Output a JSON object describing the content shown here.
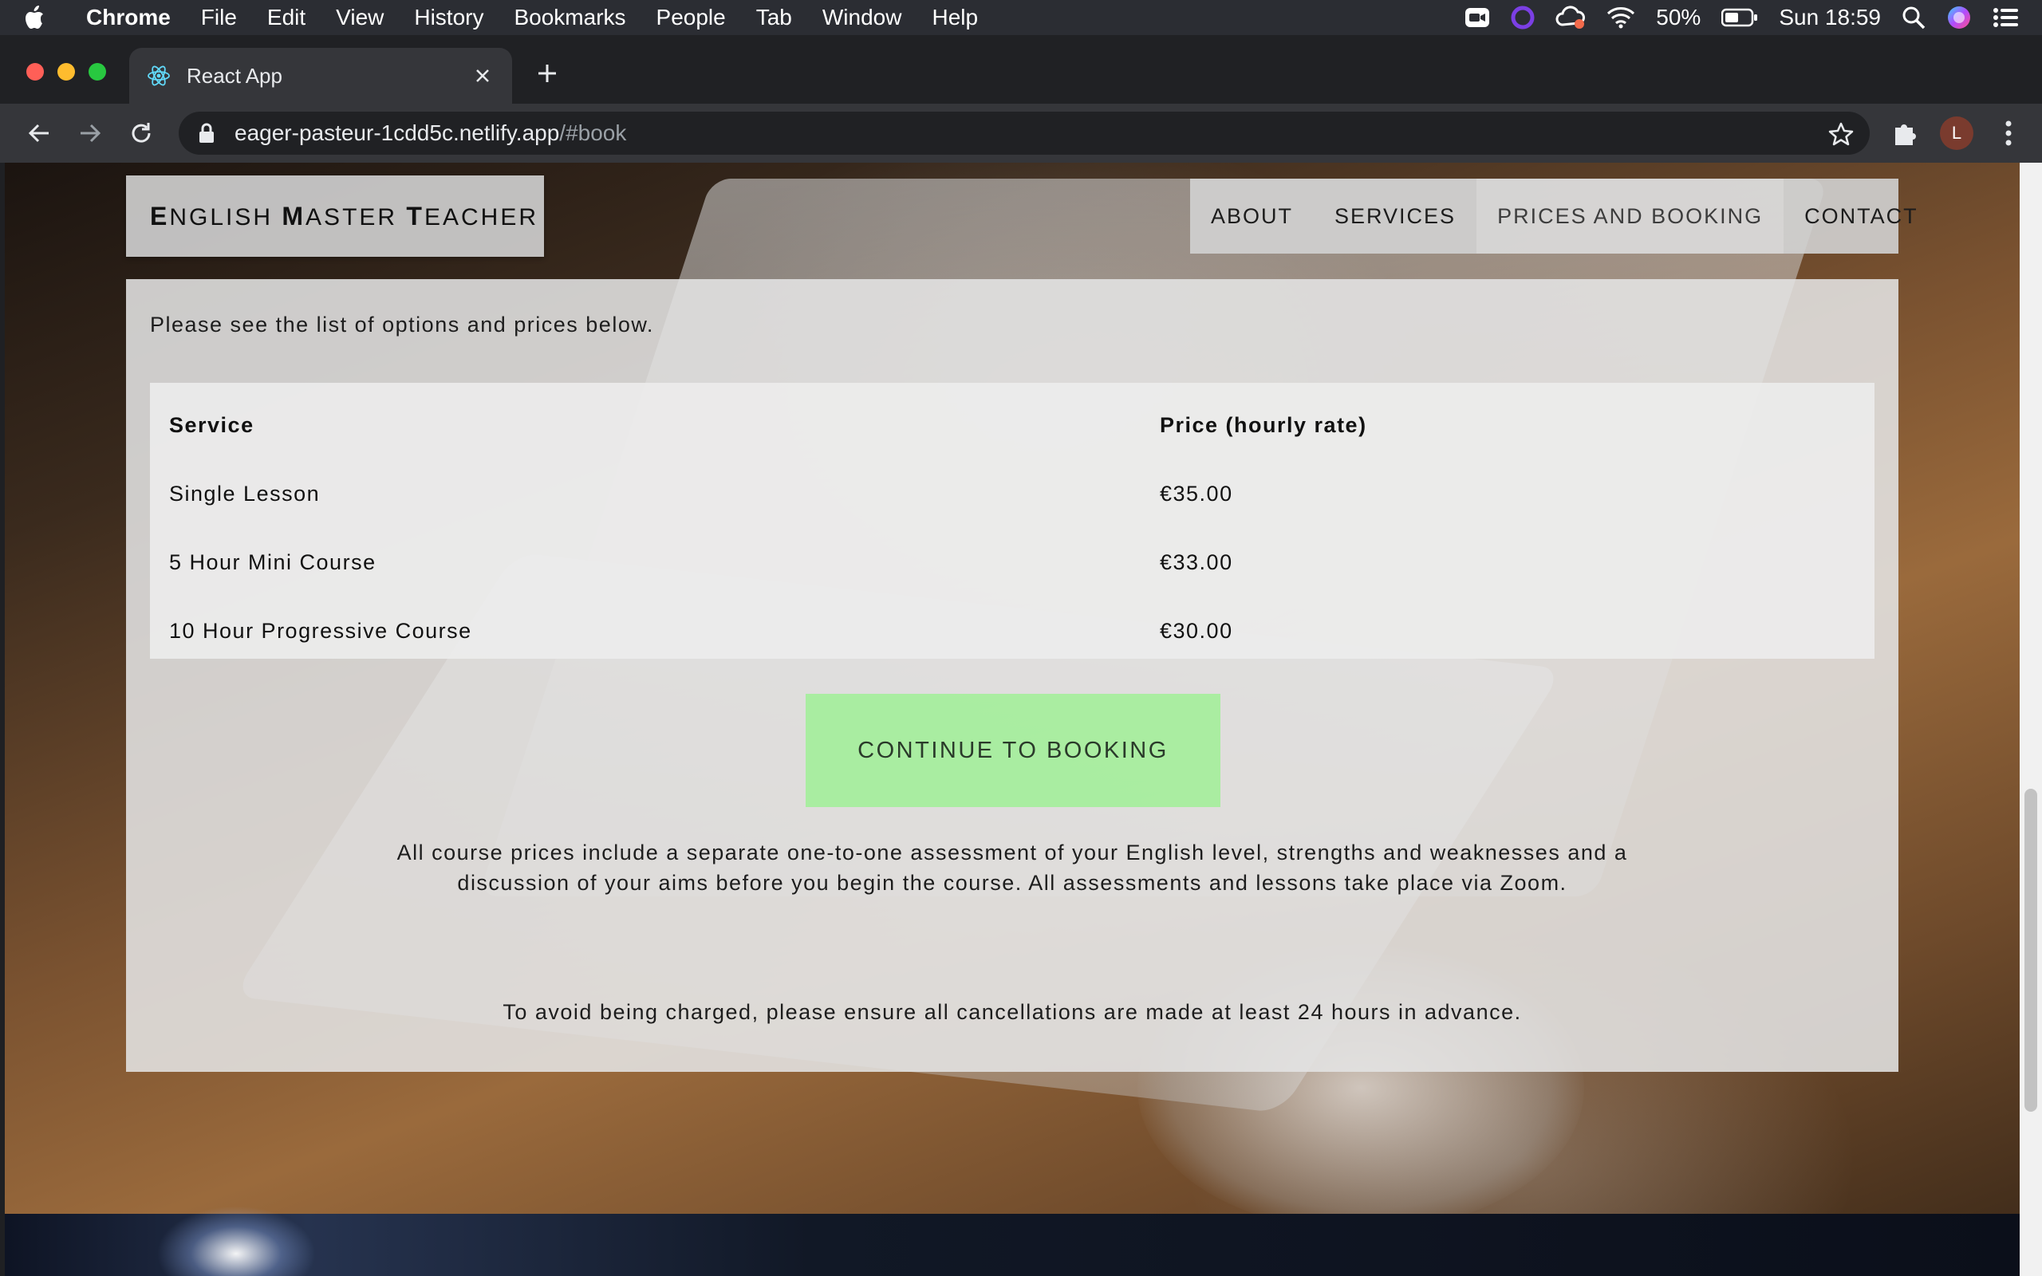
{
  "menubar": {
    "app": "Chrome",
    "items": [
      "File",
      "Edit",
      "View",
      "History",
      "Bookmarks",
      "People",
      "Tab",
      "Window",
      "Help"
    ],
    "battery": "50%",
    "clock": "Sun 18:59"
  },
  "browser": {
    "tab_title": "React App",
    "url_host": "eager-pasteur-1cdd5c.netlify.app",
    "url_path": "/#book",
    "profile_initial": "L"
  },
  "site": {
    "brand": {
      "parts": [
        {
          "cap": "E",
          "rest": "NGLISH"
        },
        {
          "cap": "M",
          "rest": "ASTER"
        },
        {
          "cap": "T",
          "rest": "EACHER"
        }
      ]
    },
    "nav": {
      "about": "ABOUT",
      "services": "SERVICES",
      "prices": "PRICES AND BOOKING",
      "contact": "CONTACT"
    }
  },
  "pricing": {
    "intro": "Please see the list of options and prices below.",
    "headers": {
      "service": "Service",
      "price": "Price (hourly rate)"
    },
    "rows": [
      {
        "service": "Single Lesson",
        "price": "€35.00"
      },
      {
        "service": "5 Hour Mini Course",
        "price": "€33.00"
      },
      {
        "service": "10 Hour Progressive Course",
        "price": "€30.00"
      }
    ],
    "cta": "CONTINUE TO BOOKING",
    "note": "All course prices include a separate one-to-one assessment of your English level, strengths and weaknesses and a discussion of your aims before you begin the course. All assessments and lessons take place via Zoom.",
    "cancellation": "To avoid being charged, please ensure all cancellations are made at least 24 hours in advance."
  },
  "colors": {
    "cta_background": "#a0f096",
    "traffic_red": "#ff5f57",
    "traffic_yellow": "#febc2e",
    "traffic_green": "#28c840"
  }
}
